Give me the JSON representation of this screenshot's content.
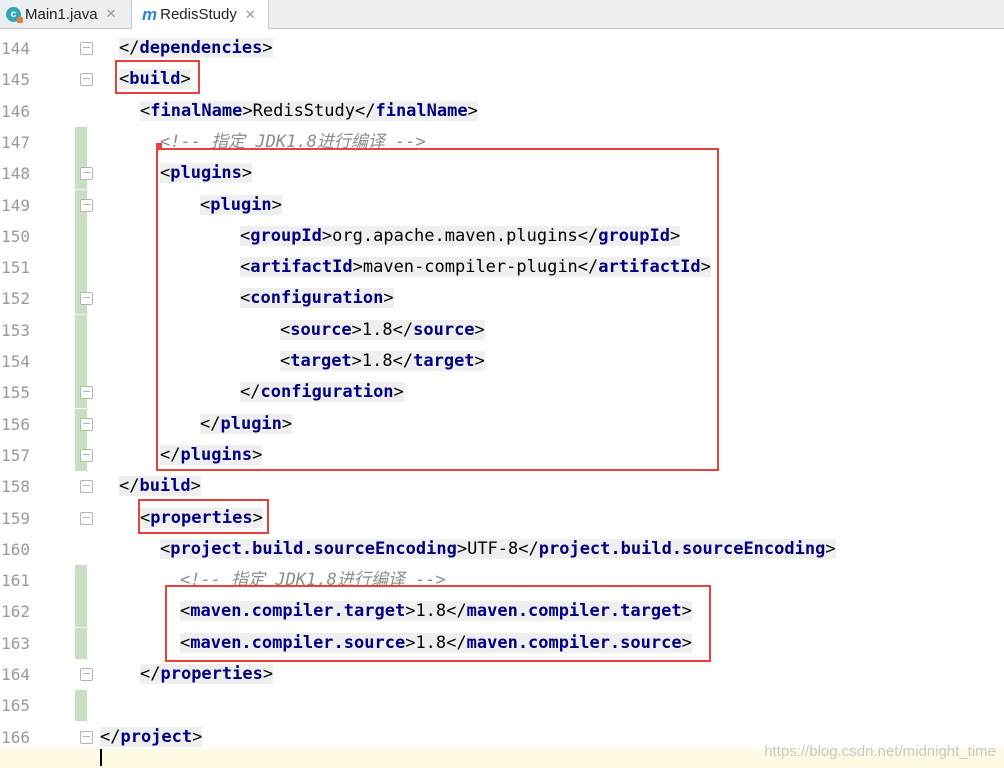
{
  "tabs": [
    {
      "label": "Main1.java",
      "icon": "java-class-icon",
      "active": false
    },
    {
      "label": "RedisStudy",
      "icon": "maven-icon",
      "active": true
    }
  ],
  "lines": [
    {
      "num": "144",
      "parts": [
        {
          "t": "</",
          "c": "tx"
        },
        {
          "t": "dependencies",
          "c": "tb"
        },
        {
          "t": ">",
          "c": "tx"
        }
      ]
    },
    {
      "num": "145",
      "parts": [
        {
          "t": "<",
          "c": "tx"
        },
        {
          "t": "build",
          "c": "tb"
        },
        {
          "t": ">",
          "c": "tx"
        }
      ]
    },
    {
      "num": "146",
      "parts": [
        {
          "t": "<",
          "c": "tx"
        },
        {
          "t": "finalName",
          "c": "tb"
        },
        {
          "t": ">",
          "c": "tx"
        },
        {
          "t": "RedisStudy",
          "c": "tx"
        },
        {
          "t": "</",
          "c": "tx"
        },
        {
          "t": "finalName",
          "c": "tb"
        },
        {
          "t": ">",
          "c": "tx"
        }
      ]
    },
    {
      "num": "147",
      "parts": [
        {
          "t": "<!-- 指定 JDK1.8进行编译 -->",
          "c": "cm"
        }
      ]
    },
    {
      "num": "148",
      "parts": [
        {
          "t": "<",
          "c": "tx"
        },
        {
          "t": "plugins",
          "c": "tb"
        },
        {
          "t": ">",
          "c": "tx"
        }
      ]
    },
    {
      "num": "149",
      "parts": [
        {
          "t": "<",
          "c": "tx"
        },
        {
          "t": "plugin",
          "c": "tb"
        },
        {
          "t": ">",
          "c": "tx"
        }
      ]
    },
    {
      "num": "150",
      "parts": [
        {
          "t": "<",
          "c": "tx"
        },
        {
          "t": "groupId",
          "c": "tb"
        },
        {
          "t": ">",
          "c": "tx"
        },
        {
          "t": "org.apache.maven.plugins",
          "c": "tx"
        },
        {
          "t": "</",
          "c": "tx"
        },
        {
          "t": "groupId",
          "c": "tb"
        },
        {
          "t": ">",
          "c": "tx"
        }
      ]
    },
    {
      "num": "151",
      "parts": [
        {
          "t": "<",
          "c": "tx"
        },
        {
          "t": "artifactId",
          "c": "tb"
        },
        {
          "t": ">",
          "c": "tx"
        },
        {
          "t": "maven-compiler-plugin",
          "c": "tx"
        },
        {
          "t": "</",
          "c": "tx"
        },
        {
          "t": "artifactId",
          "c": "tb"
        },
        {
          "t": ">",
          "c": "tx"
        }
      ]
    },
    {
      "num": "152",
      "parts": [
        {
          "t": "<",
          "c": "tx"
        },
        {
          "t": "configuration",
          "c": "tb"
        },
        {
          "t": ">",
          "c": "tx"
        }
      ]
    },
    {
      "num": "153",
      "parts": [
        {
          "t": "<",
          "c": "tx"
        },
        {
          "t": "source",
          "c": "tb"
        },
        {
          "t": ">",
          "c": "tx"
        },
        {
          "t": "1.8",
          "c": "tx"
        },
        {
          "t": "</",
          "c": "tx"
        },
        {
          "t": "source",
          "c": "tb"
        },
        {
          "t": ">",
          "c": "tx"
        }
      ]
    },
    {
      "num": "154",
      "parts": [
        {
          "t": "<",
          "c": "tx"
        },
        {
          "t": "target",
          "c": "tb"
        },
        {
          "t": ">",
          "c": "tx"
        },
        {
          "t": "1.8",
          "c": "tx"
        },
        {
          "t": "</",
          "c": "tx"
        },
        {
          "t": "target",
          "c": "tb"
        },
        {
          "t": ">",
          "c": "tx"
        }
      ]
    },
    {
      "num": "155",
      "parts": [
        {
          "t": "</",
          "c": "tx"
        },
        {
          "t": "configuration",
          "c": "tb"
        },
        {
          "t": ">",
          "c": "tx"
        }
      ]
    },
    {
      "num": "156",
      "parts": [
        {
          "t": "</",
          "c": "tx"
        },
        {
          "t": "plugin",
          "c": "tb"
        },
        {
          "t": ">",
          "c": "tx"
        }
      ]
    },
    {
      "num": "157",
      "parts": [
        {
          "t": "</",
          "c": "tx"
        },
        {
          "t": "plugins",
          "c": "tb"
        },
        {
          "t": ">",
          "c": "tx"
        }
      ]
    },
    {
      "num": "158",
      "parts": [
        {
          "t": "</",
          "c": "tx"
        },
        {
          "t": "build",
          "c": "tb"
        },
        {
          "t": ">",
          "c": "tx"
        }
      ]
    },
    {
      "num": "159",
      "parts": [
        {
          "t": "<",
          "c": "tx"
        },
        {
          "t": "properties",
          "c": "tb"
        },
        {
          "t": ">",
          "c": "tx"
        }
      ]
    },
    {
      "num": "160",
      "parts": [
        {
          "t": "<",
          "c": "tx"
        },
        {
          "t": "project.build.sourceEncoding",
          "c": "tb"
        },
        {
          "t": ">",
          "c": "tx"
        },
        {
          "t": "UTF-8",
          "c": "tx"
        },
        {
          "t": "</",
          "c": "tx"
        },
        {
          "t": "project.build.sourceEncoding",
          "c": "tb"
        },
        {
          "t": ">",
          "c": "tx"
        }
      ]
    },
    {
      "num": "161",
      "parts": [
        {
          "t": "<!-- 指定 JDK1.8进行编译 -->",
          "c": "cm"
        }
      ]
    },
    {
      "num": "162",
      "parts": [
        {
          "t": "<",
          "c": "tx"
        },
        {
          "t": "maven.compiler.target",
          "c": "tb"
        },
        {
          "t": ">",
          "c": "tx"
        },
        {
          "t": "1.8",
          "c": "tx"
        },
        {
          "t": "</",
          "c": "tx"
        },
        {
          "t": "maven.compiler.target",
          "c": "tb"
        },
        {
          "t": ">",
          "c": "tx"
        }
      ]
    },
    {
      "num": "163",
      "parts": [
        {
          "t": "<",
          "c": "tx"
        },
        {
          "t": "maven.compiler.source",
          "c": "tb"
        },
        {
          "t": ">",
          "c": "tx"
        },
        {
          "t": "1.8",
          "c": "tx"
        },
        {
          "t": "</",
          "c": "tx"
        },
        {
          "t": "maven.compiler.source",
          "c": "tb"
        },
        {
          "t": ">",
          "c": "tx"
        }
      ]
    },
    {
      "num": "164",
      "parts": [
        {
          "t": "</",
          "c": "tx"
        },
        {
          "t": "properties",
          "c": "tb"
        },
        {
          "t": ">",
          "c": "tx"
        }
      ]
    },
    {
      "num": "165",
      "parts": []
    },
    {
      "num": "166",
      "parts": [
        {
          "t": "</",
          "c": "tx"
        },
        {
          "t": "project",
          "c": "tb"
        },
        {
          "t": ">",
          "c": "tx"
        }
      ]
    }
  ],
  "watermark": "https://blog.csdn.net/midnight_time",
  "colors": {
    "tag": "#000080",
    "comment": "#8c8c8c",
    "highlight_box": "#e8413b",
    "change_marker": "#c9dfc1"
  }
}
